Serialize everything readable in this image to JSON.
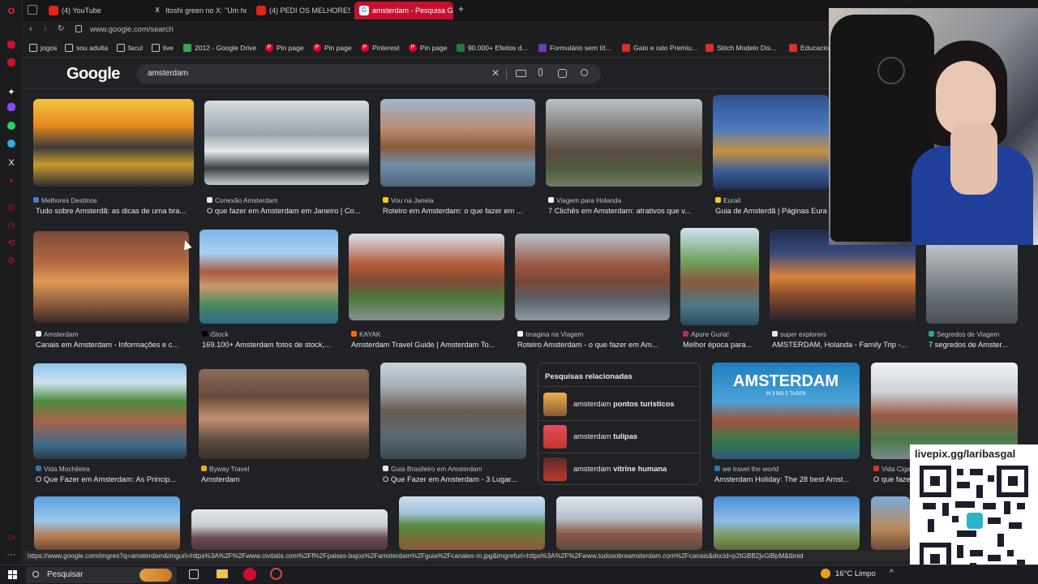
{
  "browser": {
    "tabs": [
      {
        "label": "(4) YouTube",
        "icon": "youtube-icon",
        "color": "#e62117"
      },
      {
        "label": "Itoshi green no X: \"Um ho",
        "icon": "x-icon",
        "color": "#ffffff"
      },
      {
        "label": "(4) PEDI OS MELHORES",
        "icon": "youtube-icon",
        "color": "#e62117"
      },
      {
        "label": "amsterdam - Pesquisa Go",
        "icon": "google-icon",
        "color": "#ffffff"
      }
    ],
    "new_tab": "+",
    "url": "www.google.com/search",
    "bookmarks": [
      {
        "label": "jogos",
        "icon": "folder-icon"
      },
      {
        "label": "sou adulta",
        "icon": "folder-icon"
      },
      {
        "label": "facul",
        "icon": "folder-icon"
      },
      {
        "label": "live",
        "icon": "folder-icon"
      },
      {
        "label": "2012 - Google Drive",
        "icon": "drive-icon"
      },
      {
        "label": "Pin page",
        "icon": "pinterest-icon"
      },
      {
        "label": "Pin page",
        "icon": "pinterest-icon"
      },
      {
        "label": "Pinterest",
        "icon": "pinterest-icon"
      },
      {
        "label": "Pin page",
        "icon": "pinterest-icon"
      },
      {
        "label": "90.000+ Efeitos d...",
        "icon": "envato-icon"
      },
      {
        "label": "Formulário sem tít...",
        "icon": "forms-icon"
      },
      {
        "label": "Gato e rato Premiu...",
        "icon": "shop-icon"
      },
      {
        "label": "Stitch Modelo Dis...",
        "icon": "shop-icon"
      },
      {
        "label": "Educacio",
        "icon": "shop-icon"
      }
    ]
  },
  "google": {
    "logo": "Google",
    "query": "amsterdam"
  },
  "results": {
    "row1": [
      {
        "source": "Melhores Destinos",
        "title": "Tudo sobre Amsterdã: as dicas de uma bra..."
      },
      {
        "source": "Conexão Amsterdam",
        "title": "O que fazer em Amsterdam em Janeiro | Co..."
      },
      {
        "source": "Vou na Janela",
        "title": "Roteiro em Amsterdam: o que fazer em ..."
      },
      {
        "source": "Viagem para Holanda",
        "title": "7 Clichês em Amsterdam: atrativos que v..."
      },
      {
        "source": "Eurail",
        "title": "Guia de Amsterdã | Páginas Eura"
      }
    ],
    "row2": [
      {
        "source": "Amsterdam",
        "title": "Canais em Amsterdam - Informações e c..."
      },
      {
        "source": "iStock",
        "title": "169.100+ Amsterdam fotos de stock,..."
      },
      {
        "source": "KAYAK",
        "title": "Amsterdam Travel Guide | Amsterdam To..."
      },
      {
        "source": "Imagina na Viagem",
        "title": "Roteiro Amsterdam - o que fazer em Am..."
      },
      {
        "source": "Apure Guria!",
        "title": "Melhor época para..."
      },
      {
        "source": "super explorers",
        "title": "AMSTERDAM, Holanda - Family Trip -..."
      },
      {
        "source": "Segredos de Viagem",
        "title": "7 segredos de Amster..."
      }
    ],
    "row3": [
      {
        "source": "Vida Mochileira",
        "title": "O Que Fazer em Amsterdam: As Princip..."
      },
      {
        "source": "Byway Travel",
        "title": "Amsterdam"
      },
      {
        "source": "Guia Brasileiro em Amsterdam",
        "title": "O Que Fazer em Amsterdam - 3 Lugar..."
      },
      {
        "source": "we travel the world",
        "title": "Amsterdam Holiday: The 28 best Amst..."
      },
      {
        "source": "Vida Ciga",
        "title": "O que faze"
      }
    ],
    "banner_text_1": "AMSTERDAM",
    "banner_text_2": "IN 3 BIS 5 TAGEN"
  },
  "related": {
    "heading": "Pesquisas relacionadas",
    "items": [
      {
        "prefix": "amsterdam ",
        "bold": "pontos turisticos"
      },
      {
        "prefix": "amsterdam ",
        "bold": "tulipas"
      },
      {
        "prefix": "amsterdam ",
        "bold": "vitrine humana"
      }
    ]
  },
  "status_url": "https://www.google.com/imgres?q=amsterdam&imgurl=https%3A%2F%2Fwww.civitatis.com%2Ff%2Fpaises-bajos%2Famsterdam%2Fguia%2Fcanales-m.jpg&imgrefurl=https%3A%2F%2Fwww.tudosobreamsterdam.com%2Fcanais&docid=p2tGBB2jvGlBpM&tbnid",
  "overlay": {
    "qr_label": "livepix.gg/laribasgal"
  },
  "taskbar": {
    "search_placeholder": "Pesquisar",
    "weather": "16°C  Limpo"
  }
}
